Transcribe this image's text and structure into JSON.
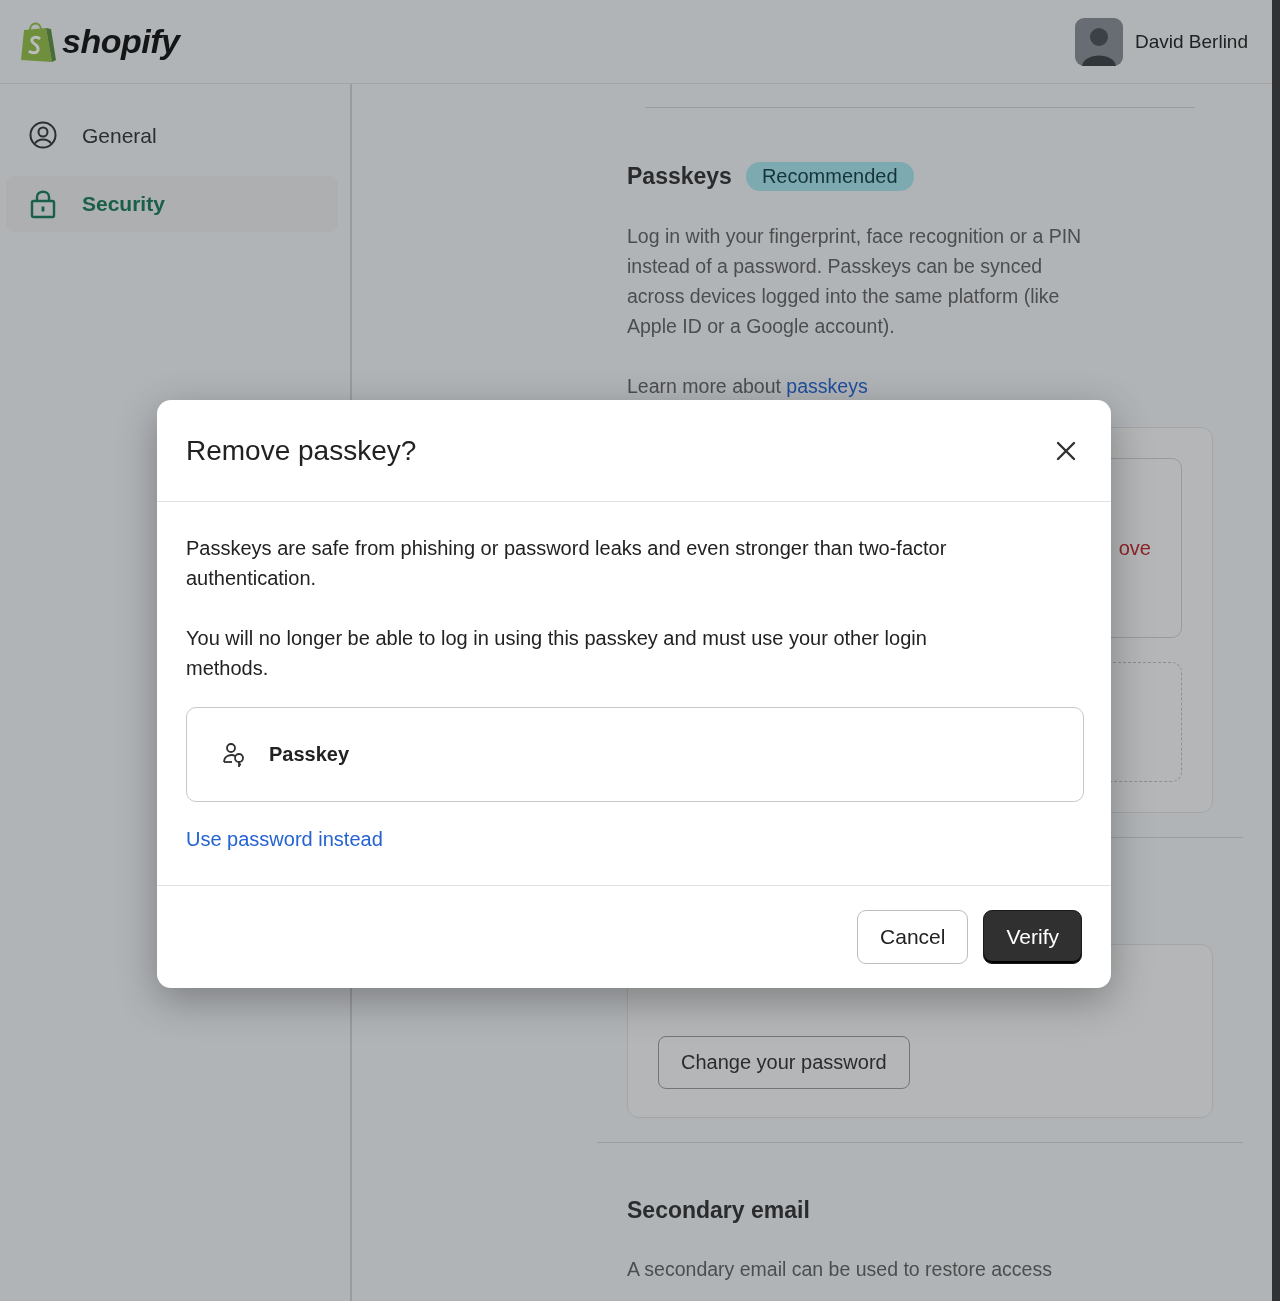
{
  "header": {
    "logo": {
      "text": "shopify"
    },
    "user": {
      "name": "David Berlind"
    }
  },
  "sidebar": {
    "items": [
      {
        "label": "General",
        "kind": "person",
        "selected": false
      },
      {
        "label": "Security",
        "kind": "lock",
        "selected": true
      }
    ]
  },
  "passkeys_section": {
    "title": "Passkeys",
    "badge": "Recommended",
    "description": "Log in with your fingerprint, face recognition or a PIN instead of a password. Passkeys can be synced across devices logged into the same platform (like Apple ID or a Google account).",
    "learn_more": {
      "text": "Learn more about",
      "link": "passkeys"
    },
    "passkey_card": {
      "remove_link": "ove"
    }
  },
  "password_section": {
    "button": "Change your password"
  },
  "secondary_email_section": {
    "title": "Secondary email",
    "description": "A secondary email can be used to restore access"
  },
  "modal": {
    "title": "Remove passkey?",
    "paragraphs": [
      "Passkeys are safe from phishing or password leaks and even stronger than two-factor authentication.",
      "You will no longer be able to log in using this passkey and must use your other login methods."
    ],
    "method": {
      "label": "Passkey"
    },
    "alt_link": "Use password instead",
    "buttons": [
      {
        "label": "Cancel",
        "kind": "secondary"
      },
      {
        "label": "Verify",
        "kind": "primary"
      }
    ]
  }
}
